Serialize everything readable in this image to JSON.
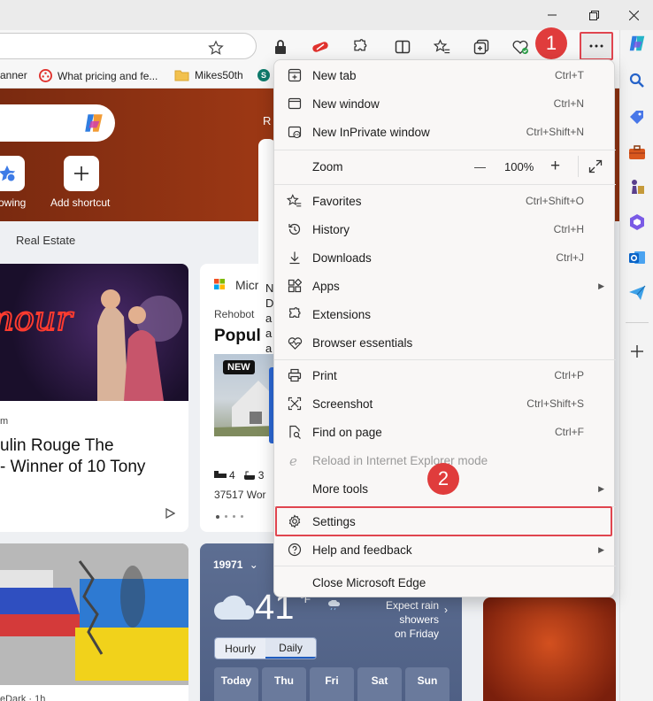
{
  "window": {
    "minimize_icon": "minimize-icon",
    "maximize_icon": "restore-icon",
    "close_icon": "close-icon"
  },
  "bookmarks": [
    {
      "label": "anner",
      "icon": "tab-icon"
    },
    {
      "label": "What pricing and fe...",
      "icon": "dots-icon"
    },
    {
      "label": "Mikes50th",
      "icon": "folder-icon"
    },
    {
      "label": "S",
      "icon": "sharepoint-icon"
    }
  ],
  "content": {
    "shortcuts": [
      {
        "label": "owing"
      },
      {
        "label": "Add shortcut"
      }
    ],
    "nav_item": "Real Estate",
    "hero_partial": "R",
    "card1": {
      "source": "m",
      "title_line1": "ulin Rouge The",
      "title_line2": "- Winner of 10 Tony"
    },
    "card2": {
      "source": "Micr",
      "location": "Rehobot",
      "title": "Popul",
      "badge": "NEW",
      "beds": "4",
      "baths": "3",
      "address": "37517 Wor"
    },
    "card_partial_letters": [
      "N",
      "D",
      "a",
      "a",
      "a"
    ],
    "weather": {
      "zip": "19971",
      "temp": "41",
      "unit": "°F",
      "forecast_line1": "Expect rain showers",
      "forecast_line2": "on Friday",
      "tab_hourly": "Hourly",
      "tab_daily": "Daily",
      "days": [
        "Today",
        "Thu",
        "Fri",
        "Sat",
        "Sun"
      ]
    },
    "card3_source": "eDark · 1h"
  },
  "menu": {
    "items": [
      {
        "label": "New tab",
        "shortcut": "Ctrl+T",
        "icon": "new-tab-icon"
      },
      {
        "label": "New window",
        "shortcut": "Ctrl+N",
        "icon": "new-window-icon"
      },
      {
        "label": "New InPrivate window",
        "shortcut": "Ctrl+Shift+N",
        "icon": "inprivate-icon"
      },
      {
        "label": "Favorites",
        "shortcut": "Ctrl+Shift+O",
        "icon": "favorites-icon"
      },
      {
        "label": "History",
        "shortcut": "Ctrl+H",
        "icon": "history-icon"
      },
      {
        "label": "Downloads",
        "shortcut": "Ctrl+J",
        "icon": "download-icon"
      },
      {
        "label": "Apps",
        "shortcut": "",
        "icon": "apps-icon"
      },
      {
        "label": "Extensions",
        "shortcut": "",
        "icon": "extensions-icon"
      },
      {
        "label": "Browser essentials",
        "shortcut": "",
        "icon": "heart-pulse-icon"
      },
      {
        "label": "Print",
        "shortcut": "Ctrl+P",
        "icon": "print-icon"
      },
      {
        "label": "Screenshot",
        "shortcut": "Ctrl+Shift+S",
        "icon": "screenshot-icon"
      },
      {
        "label": "Find on page",
        "shortcut": "Ctrl+F",
        "icon": "find-icon"
      },
      {
        "label": "Reload in Internet Explorer mode",
        "shortcut": "",
        "icon": "ie-icon"
      },
      {
        "label": "More tools",
        "shortcut": "",
        "icon": ""
      },
      {
        "label": "Settings",
        "shortcut": "",
        "icon": "gear-icon"
      },
      {
        "label": "Help and feedback",
        "shortcut": "",
        "icon": "help-icon"
      },
      {
        "label": "Close Microsoft Edge",
        "shortcut": "",
        "icon": ""
      }
    ],
    "zoom": {
      "label": "Zoom",
      "minus": "—",
      "value": "100%",
      "plus": "+"
    }
  },
  "annotations": {
    "badge1": "1",
    "badge2": "2"
  },
  "colors": {
    "accent_red": "#e0454f",
    "badge_red": "#e03c3c",
    "hero_bg": "#9b3714",
    "weather_bg": "#4e5f84"
  }
}
